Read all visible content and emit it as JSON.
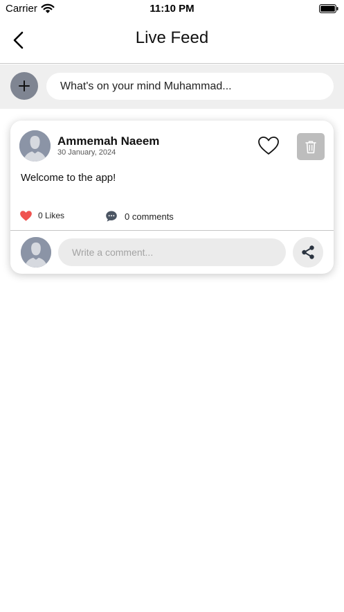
{
  "status_bar": {
    "carrier": "Carrier",
    "time": "11:10 PM",
    "battery_icon": "battery-icon",
    "wifi_icon": "wifi-icon"
  },
  "nav": {
    "title": "Live Feed",
    "back_icon": "chevron-left-icon"
  },
  "composer": {
    "placeholder": "What's on your mind Muhammad...",
    "add_icon": "plus-icon"
  },
  "post": {
    "author": "Ammemah Naeem",
    "date": "30 January, 2024",
    "text": "Welcome to the app!",
    "likes_label": "0 Likes",
    "comments_label": "0 comments",
    "comment_placeholder": "Write a comment...",
    "liked": false
  },
  "colors": {
    "heart": "#ef5350",
    "avatar_bg": "#8b94a6",
    "delete_bg": "#bdbdbd",
    "composer_bg": "#efefef"
  }
}
